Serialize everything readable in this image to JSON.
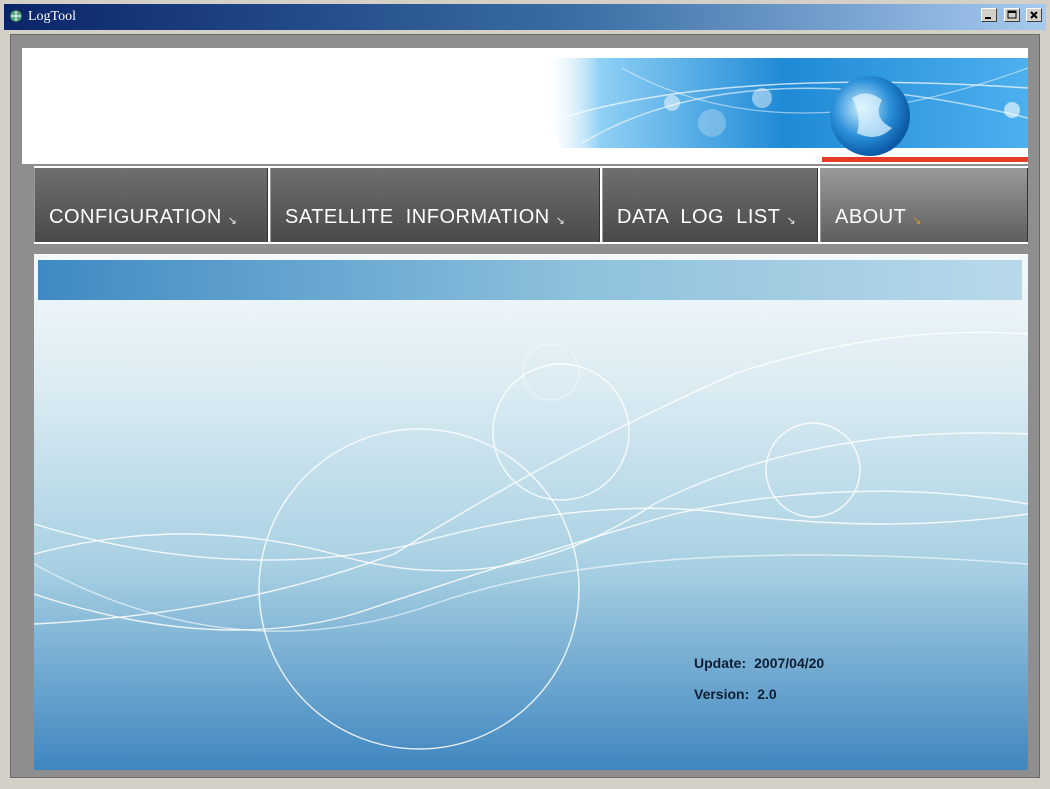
{
  "window": {
    "title": "LogTool"
  },
  "nav": {
    "tabs": [
      {
        "label": "CONFIGURATION",
        "arrow": "↘"
      },
      {
        "label": "SATELLITE  INFORMATION",
        "arrow": "↘"
      },
      {
        "label": "DATA  LOG  LIST",
        "arrow": "↘"
      },
      {
        "label": "ABOUT",
        "arrow": "↘"
      }
    ]
  },
  "about": {
    "update_label": "Update:",
    "update_value": "2007/04/20",
    "version_label": "Version:",
    "version_value": "2.0"
  },
  "colors": {
    "accent_red": "#e43b2a",
    "banner_blue": "#2e8fd8",
    "content_dark_blue": "#3f86c0"
  },
  "icons": [
    "app-icon",
    "minimize-icon",
    "maximize-icon",
    "close-icon",
    "globe-icon"
  ]
}
